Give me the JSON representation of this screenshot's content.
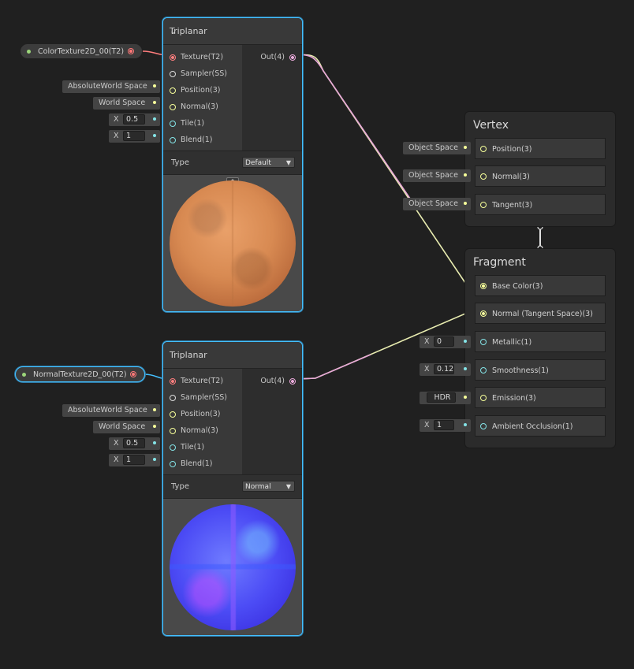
{
  "colors": {
    "texture_port": "#ff7d7d",
    "vector3_port": "#f6ff9a",
    "vector1_port": "#84e4e7",
    "color_wire": "#e8a8d8",
    "vector3_wire": "#e8ecb0",
    "selection": "#44c0ff",
    "property_dot": "#9cd67a"
  },
  "properties": [
    {
      "name": "ColorTexture2D_00(T2)"
    },
    {
      "name": "NormalTexture2D_00(T2)"
    }
  ],
  "triplanar_color": {
    "title": "Triplanar",
    "collapse_icon": "chevron-down-icon",
    "inputs": [
      "Texture(T2)",
      "Sampler(SS)",
      "Position(3)",
      "Normal(3)",
      "Tile(1)",
      "Blend(1)"
    ],
    "output": "Out(4)",
    "inline_position": "AbsoluteWorld Space",
    "inline_normal": "World Space",
    "tile_axis": "X",
    "tile_value": "0.5",
    "blend_axis": "X",
    "blend_value": "1",
    "type_label": "Type",
    "type_value": "Default",
    "preview_toggle_icon": "chevron-up-icon"
  },
  "triplanar_normal": {
    "title": "Triplanar",
    "inputs": [
      "Texture(T2)",
      "Sampler(SS)",
      "Position(3)",
      "Normal(3)",
      "Tile(1)",
      "Blend(1)"
    ],
    "output": "Out(4)",
    "inline_position": "AbsoluteWorld Space",
    "inline_normal": "World Space",
    "tile_axis": "X",
    "tile_value": "0.5",
    "blend_axis": "X",
    "blend_value": "1",
    "type_label": "Type",
    "type_value": "Normal"
  },
  "vertex": {
    "title": "Vertex",
    "slots": [
      {
        "label": "Position(3)",
        "inline": "Object Space"
      },
      {
        "label": "Normal(3)",
        "inline": "Object Space"
      },
      {
        "label": "Tangent(3)",
        "inline": "Object Space"
      }
    ]
  },
  "fragment": {
    "title": "Fragment",
    "slots": [
      {
        "label": "Base Color(3)"
      },
      {
        "label": "Normal (Tangent Space)(3)"
      },
      {
        "label": "Metallic(1)",
        "axis": "X",
        "value": "0"
      },
      {
        "label": "Smoothness(1)",
        "axis": "X",
        "value": "0.12"
      },
      {
        "label": "Emission(3)",
        "value": "HDR"
      },
      {
        "label": "Ambient Occlusion(1)",
        "axis": "X",
        "value": "1"
      }
    ]
  }
}
